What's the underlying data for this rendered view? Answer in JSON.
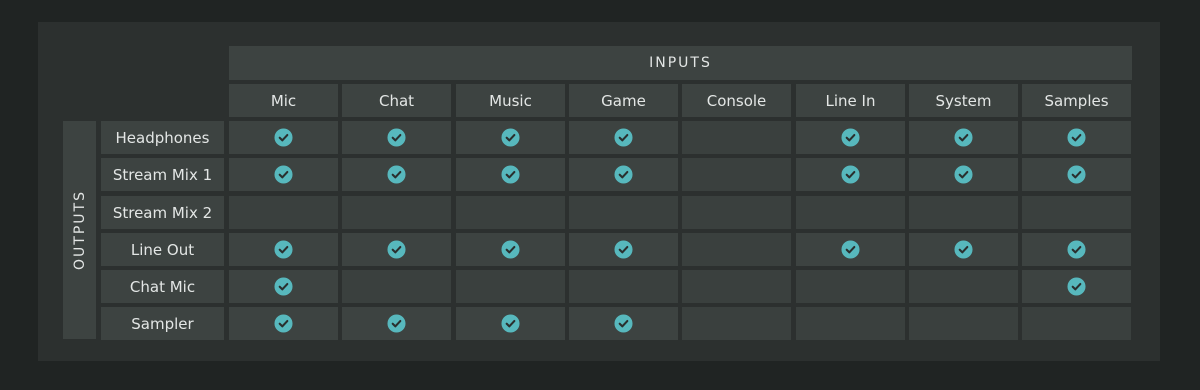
{
  "inputs_label": "INPUTS",
  "outputs_label": "OUTPUTS",
  "accent_color": "#57b8bd",
  "columns": [
    "Mic",
    "Chat",
    "Music",
    "Game",
    "Console",
    "Line In",
    "System",
    "Samples"
  ],
  "rows": [
    {
      "label": "Headphones",
      "routes": [
        true,
        true,
        true,
        true,
        false,
        true,
        true,
        true
      ]
    },
    {
      "label": "Stream Mix 1",
      "routes": [
        true,
        true,
        true,
        true,
        false,
        true,
        true,
        true
      ]
    },
    {
      "label": "Stream Mix 2",
      "routes": [
        false,
        false,
        false,
        false,
        false,
        false,
        false,
        false
      ]
    },
    {
      "label": "Line Out",
      "routes": [
        true,
        true,
        true,
        true,
        false,
        true,
        true,
        true
      ]
    },
    {
      "label": "Chat Mic",
      "routes": [
        true,
        false,
        false,
        false,
        false,
        false,
        false,
        true
      ]
    },
    {
      "label": "Sampler",
      "routes": [
        true,
        true,
        true,
        true,
        false,
        false,
        false,
        false
      ]
    }
  ],
  "check_icon": "check-circle-icon"
}
